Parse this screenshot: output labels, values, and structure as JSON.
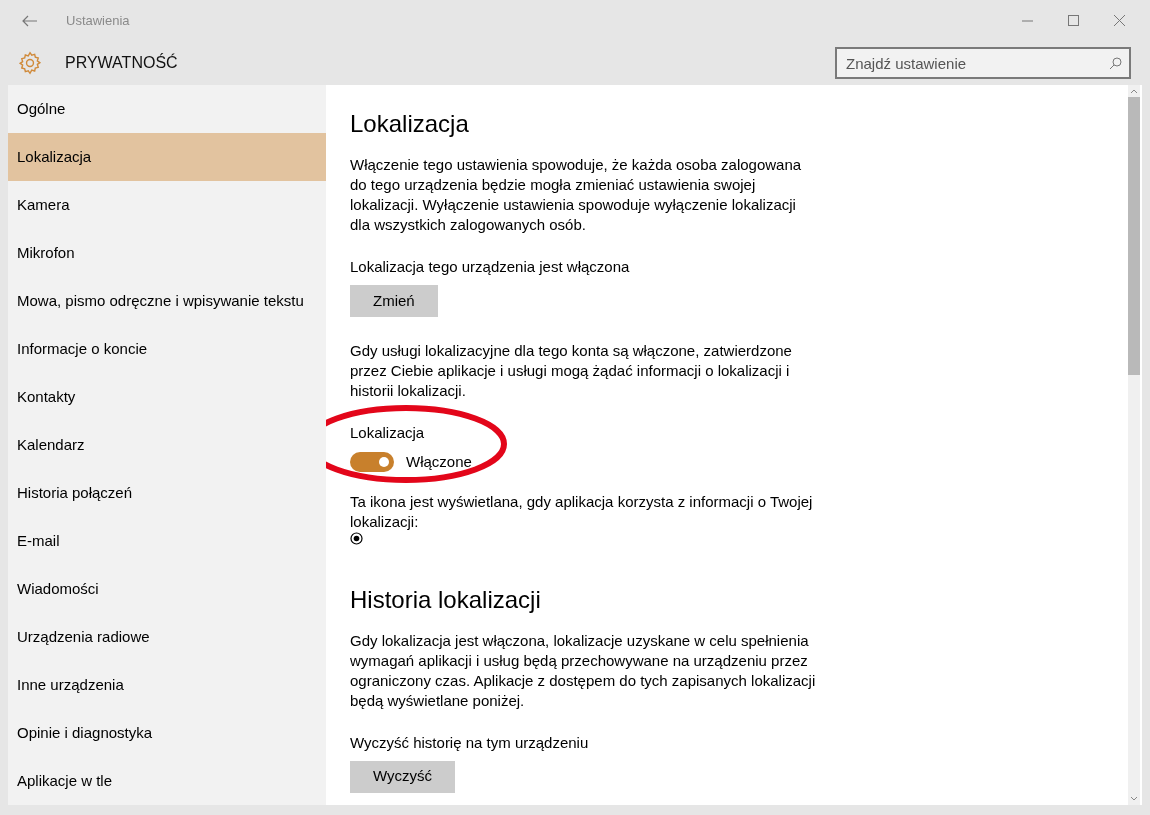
{
  "window": {
    "title": "Ustawienia"
  },
  "header": {
    "title": "PRYWATNOŚĆ",
    "search": {
      "placeholder": "Znajdź ustawienie"
    }
  },
  "sidebar": {
    "items": [
      {
        "label": "Ogólne",
        "selected": false
      },
      {
        "label": "Lokalizacja",
        "selected": true
      },
      {
        "label": "Kamera",
        "selected": false
      },
      {
        "label": "Mikrofon",
        "selected": false
      },
      {
        "label": "Mowa, pismo odręczne i wpisywanie tekstu",
        "selected": false
      },
      {
        "label": "Informacje o koncie",
        "selected": false
      },
      {
        "label": "Kontakty",
        "selected": false
      },
      {
        "label": "Kalendarz",
        "selected": false
      },
      {
        "label": "Historia połączeń",
        "selected": false
      },
      {
        "label": "E-mail",
        "selected": false
      },
      {
        "label": "Wiadomości",
        "selected": false
      },
      {
        "label": "Urządzenia radiowe",
        "selected": false
      },
      {
        "label": "Inne urządzenia",
        "selected": false
      },
      {
        "label": "Opinie i diagnostyka",
        "selected": false
      },
      {
        "label": "Aplikacje w tle",
        "selected": false
      }
    ]
  },
  "content": {
    "sections": [
      {
        "heading": "Lokalizacja",
        "blocks": [
          {
            "kind": "paragraph",
            "text": "Włączenie tego ustawienia spowoduje, że każda osoba zalogowana do tego urządzenia będzie mogła zmieniać ustawienia swojej lokalizacji. Wyłączenie ustawienia spowoduje wyłączenie lokalizacji dla wszystkich zalogowanych osób."
          },
          {
            "kind": "status",
            "text": "Lokalizacja tego urządzenia jest włączona"
          },
          {
            "kind": "button",
            "text": "Zmień"
          },
          {
            "kind": "paragraph",
            "text": "Gdy usługi lokalizacyjne dla tego konta są włączone, zatwierdzone przez Ciebie aplikacje i usługi mogą żądać informacji o lokalizacji i historii lokalizacji."
          },
          {
            "kind": "toggle",
            "label": "Lokalizacja",
            "on": true,
            "state_text": "Włączone",
            "circled": true
          },
          {
            "kind": "icon_note",
            "text": "Ta ikona jest wyświetlana, gdy aplikacja korzysta z informacji o Twojej lokalizacji:"
          }
        ]
      },
      {
        "heading": "Historia lokalizacji",
        "blocks": [
          {
            "kind": "paragraph",
            "text": "Gdy lokalizacja jest włączona, lokalizacje uzyskane w celu spełnienia wymagań aplikacji i usług będą przechowywane na urządzeniu przez ograniczony czas. Aplikacje z dostępem do tych zapisanych lokalizacji będą wyświetlane poniżej."
          },
          {
            "kind": "status",
            "text": "Wyczyść historię na tym urządzeniu"
          },
          {
            "kind": "button",
            "text": "Wyczyść"
          }
        ]
      }
    ]
  }
}
